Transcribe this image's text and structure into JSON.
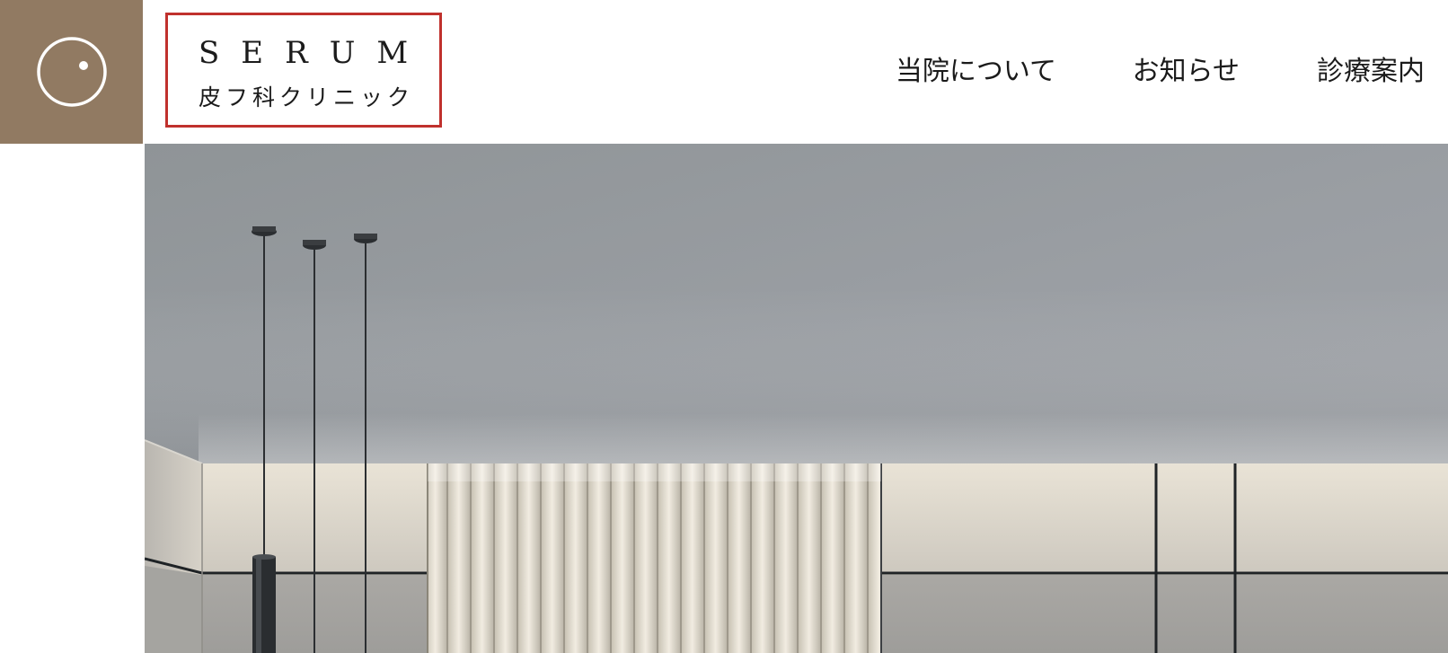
{
  "brand": {
    "icon": "circle-dot-icon",
    "color": "#917a62"
  },
  "logo": {
    "en": "SERUM",
    "ja": "皮フ科クリニック",
    "border_color": "#c0312d"
  },
  "nav": {
    "items": [
      {
        "label": "当院について"
      },
      {
        "label": "お知らせ"
      },
      {
        "label": "診療案内"
      }
    ]
  },
  "hero": {
    "description_icon": "clinic-interior-photo"
  }
}
